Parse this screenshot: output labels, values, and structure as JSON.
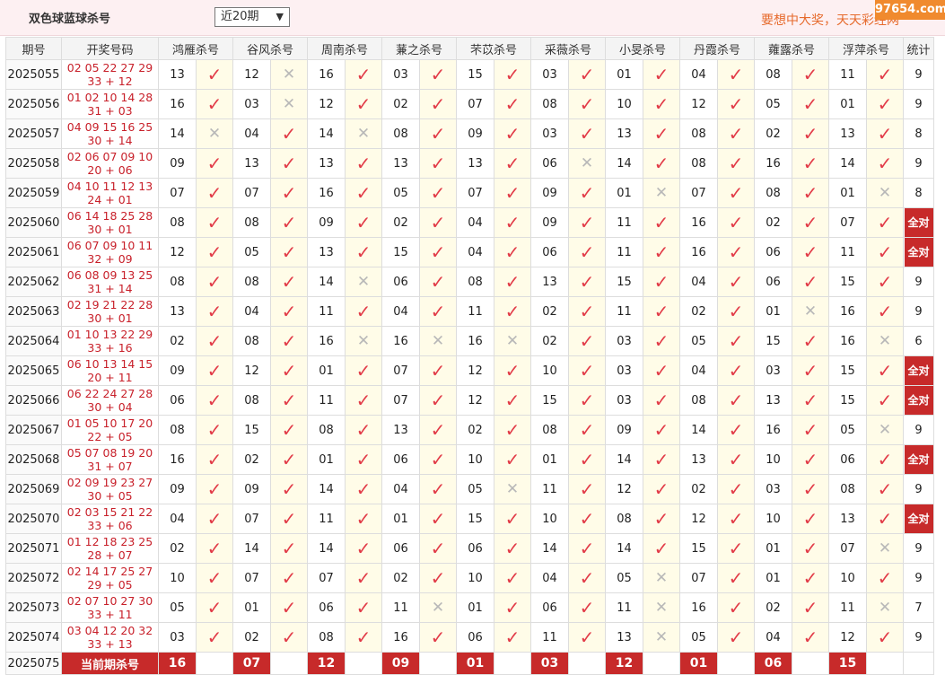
{
  "header": {
    "title": "双色球蓝球杀号",
    "range_select": "近20期",
    "slogan": "要想中大奖，天天彩经网",
    "watermark": "97654.com"
  },
  "columns": {
    "issue": "期号",
    "code": "开奖号码",
    "experts": [
      "鸿雁杀号",
      "谷风杀号",
      "周南杀号",
      "蒹之杀号",
      "芣苡杀号",
      "采薇杀号",
      "小旻杀号",
      "丹霞杀号",
      "蕹露杀号",
      "浮萍杀号"
    ],
    "stats": "统计"
  },
  "rows": [
    {
      "issue": "2025055",
      "reds": "02 05 22 27 29",
      "blue": "33 + 12",
      "kills": [
        "13",
        "12",
        "16",
        "03",
        "15",
        "03",
        "01",
        "04",
        "08",
        "11"
      ],
      "hits": [
        1,
        0,
        1,
        1,
        1,
        1,
        1,
        1,
        1,
        1
      ],
      "stat": "9"
    },
    {
      "issue": "2025056",
      "reds": "01 02 10 14 28",
      "blue": "31 + 03",
      "kills": [
        "16",
        "03",
        "12",
        "02",
        "07",
        "08",
        "10",
        "12",
        "05",
        "01"
      ],
      "hits": [
        1,
        0,
        1,
        1,
        1,
        1,
        1,
        1,
        1,
        1
      ],
      "stat": "9"
    },
    {
      "issue": "2025057",
      "reds": "04 09 15 16 25",
      "blue": "30 + 14",
      "kills": [
        "14",
        "04",
        "14",
        "08",
        "09",
        "03",
        "13",
        "08",
        "02",
        "13"
      ],
      "hits": [
        0,
        1,
        0,
        1,
        1,
        1,
        1,
        1,
        1,
        1
      ],
      "stat": "8"
    },
    {
      "issue": "2025058",
      "reds": "02 06 07 09 10",
      "blue": "20 + 06",
      "kills": [
        "09",
        "13",
        "13",
        "13",
        "13",
        "06",
        "14",
        "08",
        "16",
        "14"
      ],
      "hits": [
        1,
        1,
        1,
        1,
        1,
        0,
        1,
        1,
        1,
        1
      ],
      "stat": "9"
    },
    {
      "issue": "2025059",
      "reds": "04 10 11 12 13",
      "blue": "24 + 01",
      "kills": [
        "07",
        "07",
        "16",
        "05",
        "07",
        "09",
        "01",
        "07",
        "08",
        "01"
      ],
      "hits": [
        1,
        1,
        1,
        1,
        1,
        1,
        0,
        1,
        1,
        0
      ],
      "stat": "8"
    },
    {
      "issue": "2025060",
      "reds": "06 14 18 25 28",
      "blue": "30 + 01",
      "kills": [
        "08",
        "08",
        "09",
        "02",
        "04",
        "09",
        "11",
        "16",
        "02",
        "07"
      ],
      "hits": [
        1,
        1,
        1,
        1,
        1,
        1,
        1,
        1,
        1,
        1
      ],
      "stat": "全对"
    },
    {
      "issue": "2025061",
      "reds": "06 07 09 10 11",
      "blue": "32 + 09",
      "kills": [
        "12",
        "05",
        "13",
        "15",
        "04",
        "06",
        "11",
        "16",
        "06",
        "11"
      ],
      "hits": [
        1,
        1,
        1,
        1,
        1,
        1,
        1,
        1,
        1,
        1
      ],
      "stat": "全对"
    },
    {
      "issue": "2025062",
      "reds": "06 08 09 13 25",
      "blue": "31 + 14",
      "kills": [
        "08",
        "08",
        "14",
        "06",
        "08",
        "13",
        "15",
        "04",
        "06",
        "15"
      ],
      "hits": [
        1,
        1,
        0,
        1,
        1,
        1,
        1,
        1,
        1,
        1
      ],
      "stat": "9"
    },
    {
      "issue": "2025063",
      "reds": "02 19 21 22 28",
      "blue": "30 + 01",
      "kills": [
        "13",
        "04",
        "11",
        "04",
        "11",
        "02",
        "11",
        "02",
        "01",
        "16"
      ],
      "hits": [
        1,
        1,
        1,
        1,
        1,
        1,
        1,
        1,
        0,
        1
      ],
      "stat": "9"
    },
    {
      "issue": "2025064",
      "reds": "01 10 13 22 29",
      "blue": "33 + 16",
      "kills": [
        "02",
        "08",
        "16",
        "16",
        "16",
        "02",
        "03",
        "05",
        "15",
        "16"
      ],
      "hits": [
        1,
        1,
        0,
        0,
        0,
        1,
        1,
        1,
        1,
        0
      ],
      "stat": "6"
    },
    {
      "issue": "2025065",
      "reds": "06 10 13 14 15",
      "blue": "20 + 11",
      "kills": [
        "09",
        "12",
        "01",
        "07",
        "12",
        "10",
        "03",
        "04",
        "03",
        "15"
      ],
      "hits": [
        1,
        1,
        1,
        1,
        1,
        1,
        1,
        1,
        1,
        1
      ],
      "stat": "全对"
    },
    {
      "issue": "2025066",
      "reds": "06 22 24 27 28",
      "blue": "30 + 04",
      "kills": [
        "06",
        "08",
        "11",
        "07",
        "12",
        "15",
        "03",
        "08",
        "13",
        "15"
      ],
      "hits": [
        1,
        1,
        1,
        1,
        1,
        1,
        1,
        1,
        1,
        1
      ],
      "stat": "全对"
    },
    {
      "issue": "2025067",
      "reds": "01 05 10 17 20",
      "blue": "22 + 05",
      "kills": [
        "08",
        "15",
        "08",
        "13",
        "02",
        "08",
        "09",
        "14",
        "16",
        "05"
      ],
      "hits": [
        1,
        1,
        1,
        1,
        1,
        1,
        1,
        1,
        1,
        0
      ],
      "stat": "9"
    },
    {
      "issue": "2025068",
      "reds": "05 07 08 19 20",
      "blue": "31 + 07",
      "kills": [
        "16",
        "02",
        "01",
        "06",
        "10",
        "01",
        "14",
        "13",
        "10",
        "06"
      ],
      "hits": [
        1,
        1,
        1,
        1,
        1,
        1,
        1,
        1,
        1,
        1
      ],
      "stat": "全对"
    },
    {
      "issue": "2025069",
      "reds": "02 09 19 23 27",
      "blue": "30 + 05",
      "kills": [
        "09",
        "09",
        "14",
        "04",
        "05",
        "11",
        "12",
        "02",
        "03",
        "08"
      ],
      "hits": [
        1,
        1,
        1,
        1,
        0,
        1,
        1,
        1,
        1,
        1
      ],
      "stat": "9"
    },
    {
      "issue": "2025070",
      "reds": "02 03 15 21 22",
      "blue": "33 + 06",
      "kills": [
        "04",
        "07",
        "11",
        "01",
        "15",
        "10",
        "08",
        "12",
        "10",
        "13"
      ],
      "hits": [
        1,
        1,
        1,
        1,
        1,
        1,
        1,
        1,
        1,
        1
      ],
      "stat": "全对"
    },
    {
      "issue": "2025071",
      "reds": "01 12 18 23 25",
      "blue": "28 + 07",
      "kills": [
        "02",
        "14",
        "14",
        "06",
        "06",
        "14",
        "14",
        "15",
        "01",
        "07"
      ],
      "hits": [
        1,
        1,
        1,
        1,
        1,
        1,
        1,
        1,
        1,
        0
      ],
      "stat": "9"
    },
    {
      "issue": "2025072",
      "reds": "02 14 17 25 27",
      "blue": "29 + 05",
      "kills": [
        "10",
        "07",
        "07",
        "02",
        "10",
        "04",
        "05",
        "07",
        "01",
        "10"
      ],
      "hits": [
        1,
        1,
        1,
        1,
        1,
        1,
        0,
        1,
        1,
        1
      ],
      "stat": "9"
    },
    {
      "issue": "2025073",
      "reds": "02 07 10 27 30",
      "blue": "33 + 11",
      "kills": [
        "05",
        "01",
        "06",
        "11",
        "01",
        "06",
        "11",
        "16",
        "02",
        "11"
      ],
      "hits": [
        1,
        1,
        1,
        0,
        1,
        1,
        0,
        1,
        1,
        0
      ],
      "stat": "7"
    },
    {
      "issue": "2025074",
      "reds": "03 04 12 20 32",
      "blue": "33 + 13",
      "kills": [
        "03",
        "02",
        "08",
        "16",
        "06",
        "11",
        "13",
        "05",
        "04",
        "12"
      ],
      "hits": [
        1,
        1,
        1,
        1,
        1,
        1,
        0,
        1,
        1,
        1
      ],
      "stat": "9"
    }
  ],
  "current": {
    "issue": "2025075",
    "label": "当前期杀号",
    "kills": [
      "16",
      "07",
      "12",
      "09",
      "01",
      "03",
      "12",
      "01",
      "06",
      "15"
    ]
  },
  "icons": {
    "hit": "check-icon",
    "miss": "cross-icon"
  },
  "colors": {
    "accent": "#c72a2a",
    "hit": "#e23b48",
    "miss": "#b8b8b8",
    "code": "#c8202a"
  }
}
